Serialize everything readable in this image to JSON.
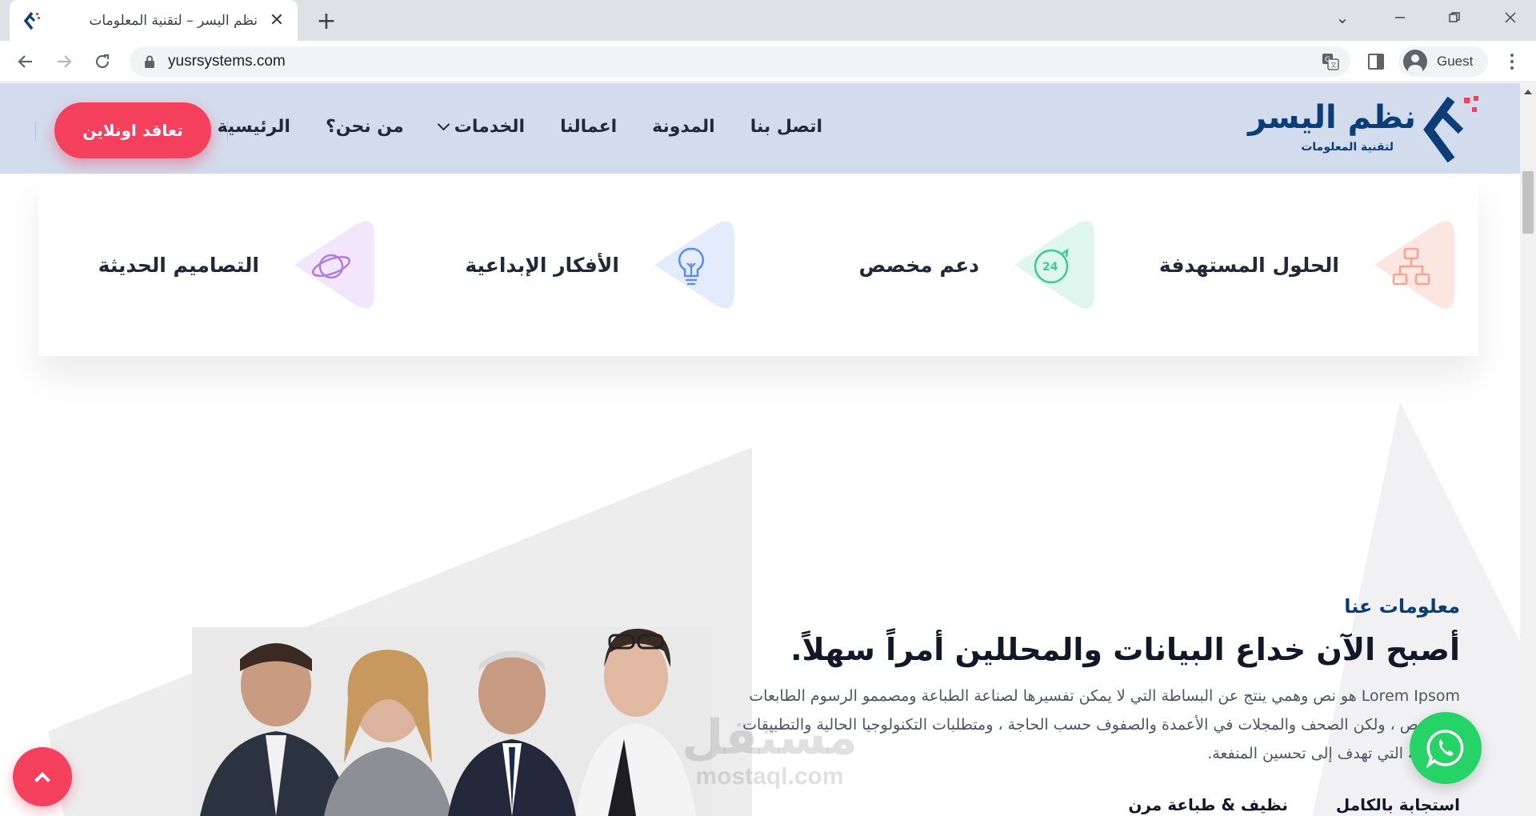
{
  "browser": {
    "tab_title": "نظم اليسر – لتقنية المعلومات",
    "url": "yusrsystems.com",
    "profile_label": "Guest",
    "icons": [
      "site-favicon",
      "close-icon",
      "plus-icon",
      "chevron-down-icon",
      "minimize-icon",
      "restore-icon",
      "close-icon",
      "back-arrow-icon",
      "forward-arrow-icon",
      "reload-icon",
      "lock-icon",
      "translate-icon",
      "side-panel-icon",
      "avatar-icon",
      "menu-dots-icon"
    ]
  },
  "header": {
    "logo_title": "نظم اليسر",
    "logo_subtitle": "لتقنية المعلومات",
    "nav": [
      "الرئيسية",
      "من نحن؟",
      "الخدمات",
      "اعمالنا",
      "المدونة",
      "اتصل بنا"
    ],
    "cta_label": "تعاقد اونلاين"
  },
  "features": [
    {
      "title": "الحلول المستهدفة",
      "icon": "sitemap-icon",
      "color": "#f7a48a"
    },
    {
      "title": "دعم مخصص",
      "icon": "support-24-icon",
      "color": "#3cc99b"
    },
    {
      "title": "الأفكار الإبداعية",
      "icon": "lightbulb-icon",
      "color": "#5b8def"
    },
    {
      "title": "التصاميم الحديثة",
      "icon": "planet-icon",
      "color": "#b27be0"
    }
  ],
  "about": {
    "kicker": "معلومات عنا",
    "title": "أصبح الآن خداع البيانات والمحللين أمراً سهلاً.",
    "text": "Lorem Ipsom هو نص وهمي ينتج عن البساطة التي لا يمكن تفسيرها لصناعة الطباعة ومصممو الرسوم الطابعات والنصوص ، ولكن الصحف والمجلات في الأعمدة والصفوف حسب الحاجة ، ومتطلبات التكنولوجيا الحالية والتطبيقات المتنوعة التي تهدف إلى تحسين المنفعة.",
    "bottom_items": [
      "استجابة بالكامل",
      "نظيف & طباعة مرن"
    ]
  },
  "watermark": {
    "line1": "مستقل",
    "line2": "mostaql.com"
  },
  "colors": {
    "accent": "#f4405c",
    "brand": "#0b3e77",
    "header_bg": "#d2dced",
    "whatsapp": "#25d366"
  }
}
